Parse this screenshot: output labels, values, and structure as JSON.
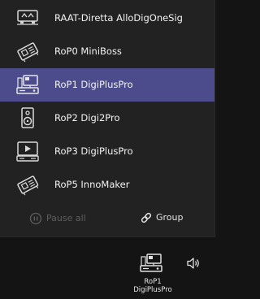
{
  "zones": [
    {
      "label": "RAAT-Diretta AlloDigOneSig",
      "icon": "server-device-icon",
      "selected": false
    },
    {
      "label": "RoP0 MiniBoss",
      "icon": "board-icon",
      "selected": false
    },
    {
      "label": "RoP1 DigiPlusPro",
      "icon": "computer-display-icon",
      "selected": true
    },
    {
      "label": "RoP2 Digi2Pro",
      "icon": "speaker-icon",
      "selected": false
    },
    {
      "label": "RoP3 DigiPlusPro",
      "icon": "media-player-icon",
      "selected": false
    },
    {
      "label": "RoP5 InnoMaker",
      "icon": "board-icon",
      "selected": false
    }
  ],
  "actions": {
    "pause_label": "Pause all",
    "group_label": "Group"
  },
  "taskbar": {
    "zone_line1": "RoP1",
    "zone_line2": "DigiPlusPro",
    "volume_icon": "speaker-volume-icon"
  },
  "colors": {
    "selected": "#4c4c8c",
    "panel": "#222222",
    "background": "#141414"
  }
}
